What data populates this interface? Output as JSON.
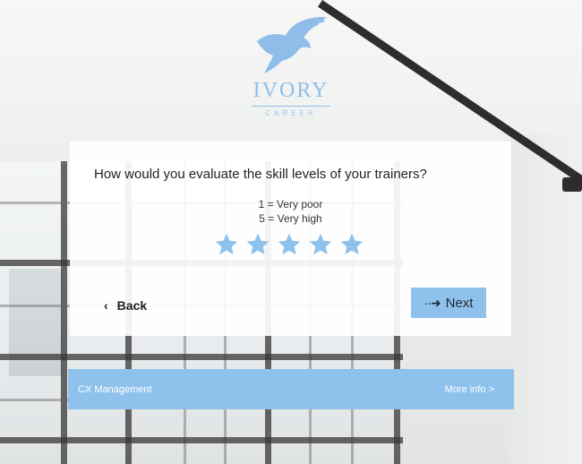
{
  "brand": {
    "name": "IVORY",
    "tagline": "CAREER",
    "logo_icon": "eagle-icon",
    "color": "#8fbde9"
  },
  "survey": {
    "question": "How would you evaluate the skill levels of your trainers?",
    "scale_low": "1 = Very poor",
    "scale_high": "5 = Very high",
    "rating_max": 5,
    "star_icon": "star-icon",
    "star_color": "#8ec2ed",
    "back_label": "Back",
    "back_icon": "chevron-left-icon",
    "next_label": "Next",
    "next_icon": "arrow-right-icon",
    "accent_color": "#8ec2ed"
  },
  "footer": {
    "left_label": "CX Management",
    "right_label": "More info >"
  }
}
